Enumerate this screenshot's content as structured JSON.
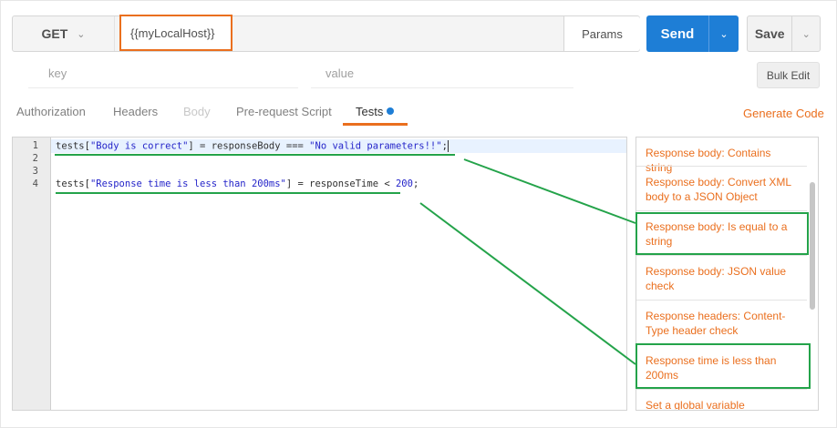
{
  "request": {
    "method": "GET",
    "url": "{{myLocalHost}}",
    "params_label": "Params",
    "send_label": "Send",
    "save_label": "Save"
  },
  "params_row": {
    "key_placeholder": "key",
    "value_placeholder": "value",
    "bulk_edit_label": "Bulk Edit"
  },
  "tabs": [
    {
      "label": "Authorization",
      "state": "normal"
    },
    {
      "label": "Headers",
      "state": "normal"
    },
    {
      "label": "Body",
      "state": "disabled"
    },
    {
      "label": "Pre-request Script",
      "state": "normal"
    },
    {
      "label": "Tests",
      "state": "active"
    }
  ],
  "generate_code_label": "Generate Code",
  "editor": {
    "line_numbers": [
      "1",
      "2",
      "3",
      "4"
    ],
    "lines": [
      {
        "a": "tests[",
        "s1": "\"Body is correct\"",
        "b": "] = responseBody === ",
        "s2": "\"No valid parameters!!\"",
        "c": ";"
      },
      {
        "text": ""
      },
      {
        "text": ""
      },
      {
        "a": "tests[",
        "s1": "\"Response time is less than 200ms\"",
        "b": "] = responseTime < ",
        "s2": "200",
        "c": ";"
      }
    ]
  },
  "snippets": [
    {
      "l1": "Response body: Contains string",
      "l2": ""
    },
    {
      "l1": "Response body: Convert XML",
      "l2": "body to a JSON Object"
    },
    {
      "l1": "Response body: Is equal to a",
      "l2": "string"
    },
    {
      "l1": "Response body: JSON value",
      "l2": "check"
    },
    {
      "l1": "Response headers: Content-",
      "l2": "Type header check"
    },
    {
      "l1": "Response time is less than",
      "l2": "200ms"
    },
    {
      "l1": "Set a global variable",
      "l2": ""
    }
  ],
  "colors": {
    "accent_orange": "#ea6f1e",
    "send_blue": "#1e7ed6",
    "annotation_green": "#24a34a"
  }
}
